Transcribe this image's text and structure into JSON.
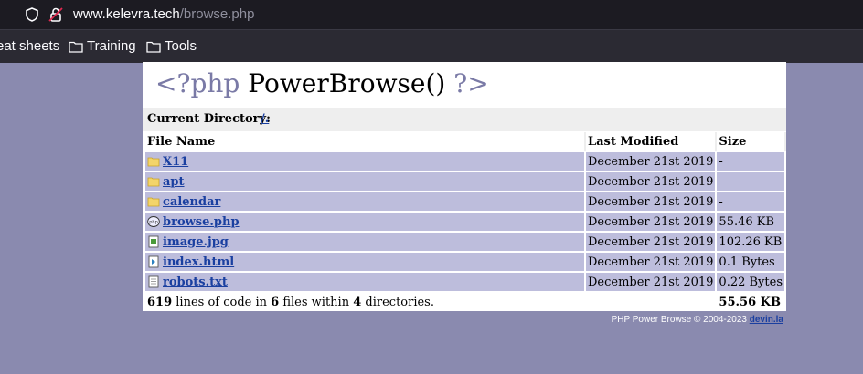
{
  "browser": {
    "url_host": "www.kelevra.tech",
    "url_path": "/browse.php",
    "bookmarks": [
      {
        "label": "eat sheets",
        "folder": false
      },
      {
        "label": "Training",
        "folder": true
      },
      {
        "label": "Tools",
        "folder": true
      }
    ]
  },
  "page": {
    "title_open": "<?php",
    "title_fn": "PowerBrowse()",
    "title_close": "?>",
    "current_directory_label": "Current Directory:",
    "current_directory_value": "/.",
    "columns": {
      "name": "File Name",
      "modified": "Last Modified",
      "size": "Size"
    },
    "files": [
      {
        "name": "X11",
        "icon": "folder-icon",
        "modified": "December 21st 2019",
        "size": "-"
      },
      {
        "name": "apt",
        "icon": "folder-icon",
        "modified": "December 21st 2019",
        "size": "-"
      },
      {
        "name": "calendar",
        "icon": "folder-icon",
        "modified": "December 21st 2019",
        "size": "-"
      },
      {
        "name": "browse.php",
        "icon": "php-file-icon",
        "modified": "December 21st 2019",
        "size": "55.46 KB"
      },
      {
        "name": "image.jpg",
        "icon": "image-file-icon",
        "modified": "December 21st 2019",
        "size": "102.26 KB"
      },
      {
        "name": "index.html",
        "icon": "html-file-icon",
        "modified": "December 21st 2019",
        "size": "0.1 Bytes"
      },
      {
        "name": "robots.txt",
        "icon": "text-file-icon",
        "modified": "December 21st 2019",
        "size": "0.22 Bytes"
      }
    ],
    "summary": {
      "lines": "619",
      "lines_text": " lines of code in ",
      "files": "6",
      "files_text": " files within ",
      "dirs": "4",
      "dirs_text": " directories.",
      "total_size": "55.56 KB"
    },
    "credit_text": "PHP Power Browse © 2004-2023 ",
    "credit_link": "devin.la"
  },
  "colors": {
    "background": "#8a8aaf",
    "row": "#bdbddc",
    "link": "#1a3fa0",
    "tag": "#7a7aa6"
  }
}
